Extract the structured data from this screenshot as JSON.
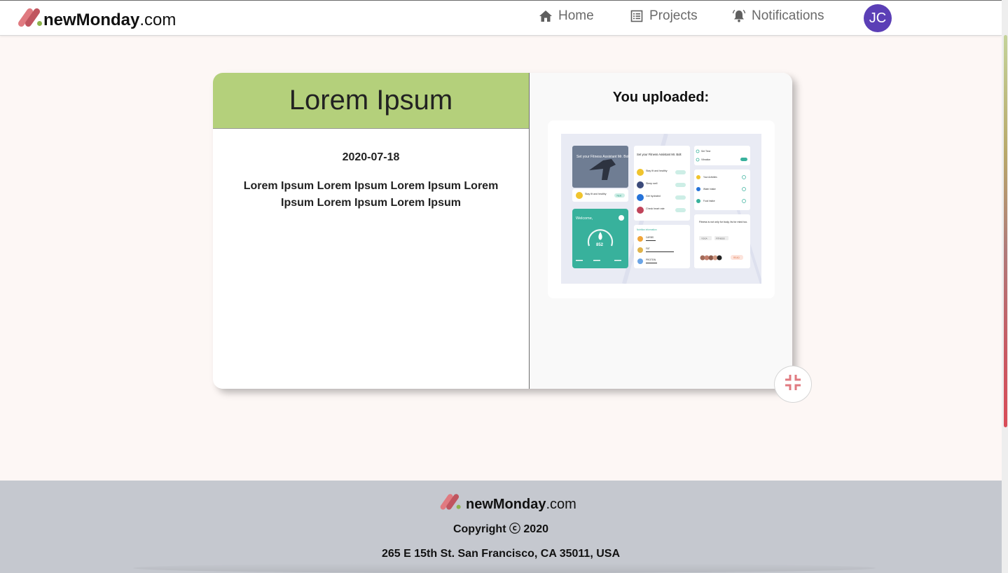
{
  "brand": {
    "name_bold": "newMonday",
    "name_suffix": ".com"
  },
  "nav": {
    "home": {
      "label": "Home",
      "icon": "home-icon"
    },
    "projects": {
      "label": "Projects",
      "icon": "list-icon"
    },
    "notifications": {
      "label": "Notifications",
      "icon": "bell-icon"
    },
    "avatar_initials": "JC"
  },
  "card": {
    "title": "Lorem Ipsum",
    "date": "2020-07-18",
    "description": "Lorem Ipsum Lorem Ipsum Lorem Ipsum Lorem Ipsum Lorem Ipsum Lorem Ipsum",
    "uploaded_heading": "You uploaded:",
    "shrink_icon": "collapse-icon"
  },
  "upload_preview": {
    "hero_caption": "Set your Fitness Assistant Mr. Bolt",
    "welcome": "Welcome,",
    "gauge_value": "852",
    "list_heading": "Set your Fitness Assistant Mr. Bolt",
    "list_items": [
      "Stay fit and healthy",
      "Sleep well",
      "Get hydrated",
      "Check heart rate"
    ],
    "tag": "Next",
    "settings": [
      "Set Time",
      "Vibration"
    ],
    "activities": [
      "Your Activities",
      "Water intake",
      "Food intake"
    ],
    "nutrition_heading": "Nutrition information",
    "nutrients": [
      "CARBS",
      "FAT",
      "PROTEIN"
    ],
    "quote": "Fitness is not only for body, Its for mind too.",
    "chips": [
      "YOGA",
      "FITNESS"
    ],
    "read": "READ"
  },
  "footer": {
    "copyright": "Copyright ⓒ 2020",
    "address": "265 E 15th St. San Francisco, CA 35011, USA"
  },
  "colors": {
    "accent_green": "#b4d07b",
    "avatar_purple": "#5b3fb6",
    "logo_pink": "#e07a80",
    "logo_red": "#c0555f",
    "logo_dot": "#8cb34a",
    "footer_bg": "#c5c8cf",
    "page_bg": "#fdf7f5"
  }
}
